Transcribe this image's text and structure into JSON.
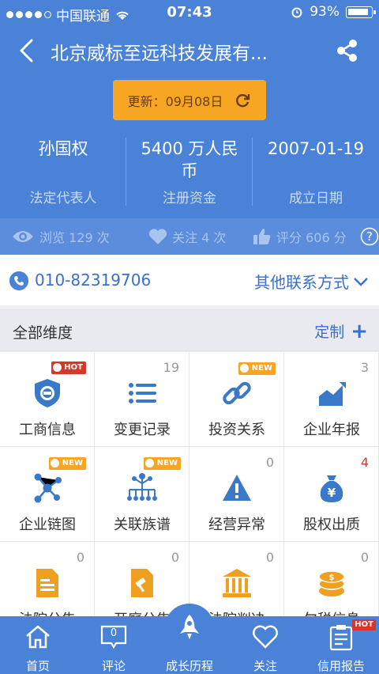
{
  "status": {
    "carrier": "中国联通",
    "time": "07:43",
    "battery": "93%"
  },
  "nav": {
    "title": "北京威标至远科技发展有..."
  },
  "update": {
    "label": "更新：09月08日"
  },
  "stats": [
    {
      "value": "孙国权",
      "label": "法定代表人"
    },
    {
      "value": "5400 万人民币",
      "label": "注册资金"
    },
    {
      "value": "2007-01-19",
      "label": "成立日期"
    }
  ],
  "counts": {
    "views": "浏览 129 次",
    "follows": "关注 4 次",
    "score": "评分 606 分"
  },
  "contact": {
    "phone": "010-82319706",
    "other": "其他联系方式"
  },
  "dimensions": {
    "title": "全部维度",
    "custom": "定制"
  },
  "tiles": [
    {
      "label": "工商信息",
      "icon": "shield-icon",
      "tag": "HOT"
    },
    {
      "label": "变更记录",
      "icon": "list-icon",
      "count": "19"
    },
    {
      "label": "投资关系",
      "icon": "link-icon",
      "tag": "NEW"
    },
    {
      "label": "企业年报",
      "icon": "chart-icon",
      "count": "3"
    },
    {
      "label": "企业链图",
      "icon": "network-icon",
      "tag": "NEW"
    },
    {
      "label": "关联族谱",
      "icon": "tree-icon",
      "tag": "NEW"
    },
    {
      "label": "经营异常",
      "icon": "warning-icon",
      "count": "0"
    },
    {
      "label": "股权出质",
      "icon": "money-bag-icon",
      "count": "4"
    },
    {
      "label": "法院公告",
      "icon": "document-icon",
      "count": "0"
    },
    {
      "label": "开庭公告",
      "icon": "hammer-doc-icon",
      "count": "0"
    },
    {
      "label": "法院判决",
      "icon": "courthouse-icon",
      "count": "0"
    },
    {
      "label": "欠税信息",
      "icon": "coins-icon",
      "count": "0"
    }
  ],
  "tabs": [
    {
      "label": "首页",
      "icon": "home-icon"
    },
    {
      "label": "评论",
      "icon": "comment-icon",
      "badge": "0"
    },
    {
      "label": "成长历程",
      "icon": "rocket-icon"
    },
    {
      "label": "关注",
      "icon": "heart-icon"
    },
    {
      "label": "信用报告",
      "icon": "report-icon",
      "tag": "HOT"
    }
  ],
  "colors": {
    "brand": "#4a82d8",
    "accent": "#f6a623",
    "hot": "#d9362b"
  }
}
